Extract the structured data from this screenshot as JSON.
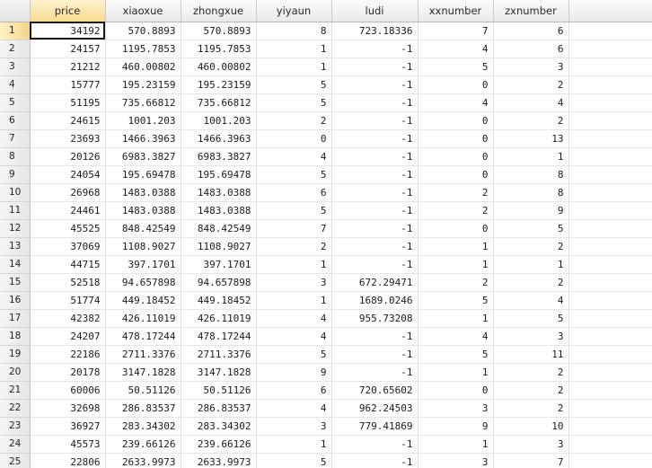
{
  "columns": [
    "price",
    "xiaoxue",
    "zhongxue",
    "yiyaun",
    "ludi",
    "xxnumber",
    "zxnumber"
  ],
  "rows": [
    {
      "n": "1",
      "cells": [
        "34192",
        "570.8893",
        "570.8893",
        "8",
        "723.18336",
        "7",
        "6"
      ]
    },
    {
      "n": "2",
      "cells": [
        "24157",
        "1195.7853",
        "1195.7853",
        "1",
        "-1",
        "4",
        "6"
      ]
    },
    {
      "n": "3",
      "cells": [
        "21212",
        "460.00802",
        "460.00802",
        "1",
        "-1",
        "5",
        "3"
      ]
    },
    {
      "n": "4",
      "cells": [
        "15777",
        "195.23159",
        "195.23159",
        "5",
        "-1",
        "0",
        "2"
      ]
    },
    {
      "n": "5",
      "cells": [
        "51195",
        "735.66812",
        "735.66812",
        "5",
        "-1",
        "4",
        "4"
      ]
    },
    {
      "n": "6",
      "cells": [
        "24615",
        "1001.203",
        "1001.203",
        "2",
        "-1",
        "0",
        "2"
      ]
    },
    {
      "n": "7",
      "cells": [
        "23693",
        "1466.3963",
        "1466.3963",
        "0",
        "-1",
        "0",
        "13"
      ]
    },
    {
      "n": "8",
      "cells": [
        "20126",
        "6983.3827",
        "6983.3827",
        "4",
        "-1",
        "0",
        "1"
      ]
    },
    {
      "n": "9",
      "cells": [
        "24054",
        "195.69478",
        "195.69478",
        "5",
        "-1",
        "0",
        "8"
      ]
    },
    {
      "n": "10",
      "cells": [
        "26968",
        "1483.0388",
        "1483.0388",
        "6",
        "-1",
        "2",
        "8"
      ]
    },
    {
      "n": "11",
      "cells": [
        "24461",
        "1483.0388",
        "1483.0388",
        "5",
        "-1",
        "2",
        "9"
      ]
    },
    {
      "n": "12",
      "cells": [
        "45525",
        "848.42549",
        "848.42549",
        "7",
        "-1",
        "0",
        "5"
      ]
    },
    {
      "n": "13",
      "cells": [
        "37069",
        "1108.9027",
        "1108.9027",
        "2",
        "-1",
        "1",
        "2"
      ]
    },
    {
      "n": "14",
      "cells": [
        "44715",
        "397.1701",
        "397.1701",
        "1",
        "-1",
        "1",
        "1"
      ]
    },
    {
      "n": "15",
      "cells": [
        "52518",
        "94.657898",
        "94.657898",
        "3",
        "672.29471",
        "2",
        "2"
      ]
    },
    {
      "n": "16",
      "cells": [
        "51774",
        "449.18452",
        "449.18452",
        "1",
        "1689.0246",
        "5",
        "4"
      ]
    },
    {
      "n": "17",
      "cells": [
        "42382",
        "426.11019",
        "426.11019",
        "4",
        "955.73208",
        "1",
        "5"
      ]
    },
    {
      "n": "18",
      "cells": [
        "24207",
        "478.17244",
        "478.17244",
        "4",
        "-1",
        "4",
        "3"
      ]
    },
    {
      "n": "19",
      "cells": [
        "22186",
        "2711.3376",
        "2711.3376",
        "5",
        "-1",
        "5",
        "11"
      ]
    },
    {
      "n": "20",
      "cells": [
        "20178",
        "3147.1828",
        "3147.1828",
        "9",
        "-1",
        "1",
        "2"
      ]
    },
    {
      "n": "21",
      "cells": [
        "60006",
        "50.51126",
        "50.51126",
        "6",
        "720.65602",
        "0",
        "2"
      ]
    },
    {
      "n": "22",
      "cells": [
        "32698",
        "286.83537",
        "286.83537",
        "4",
        "962.24503",
        "3",
        "2"
      ]
    },
    {
      "n": "23",
      "cells": [
        "36927",
        "283.34302",
        "283.34302",
        "3",
        "779.41869",
        "9",
        "10"
      ]
    },
    {
      "n": "24",
      "cells": [
        "45573",
        "239.66126",
        "239.66126",
        "1",
        "-1",
        "1",
        "3"
      ]
    },
    {
      "n": "25",
      "cells": [
        "22806",
        "2633.9973",
        "2633.9973",
        "5",
        "-1",
        "3",
        "7"
      ]
    }
  ],
  "selection": {
    "row": 0,
    "col": 0
  }
}
